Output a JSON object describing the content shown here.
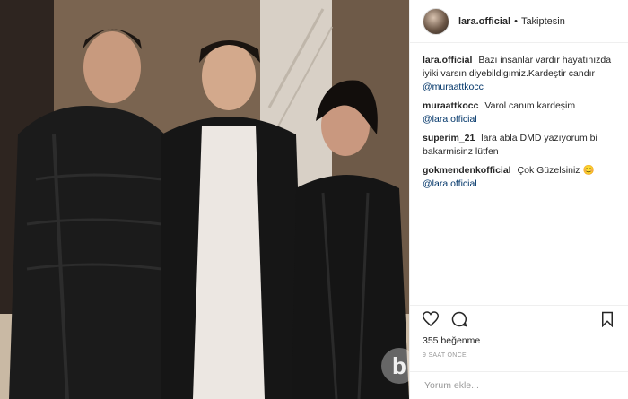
{
  "header": {
    "username": "lara.official",
    "separator": "•",
    "follow_status": "Takiptesin"
  },
  "comments": [
    {
      "user": "lara.official",
      "text": "Bazı insanlar vardır hayatınızda iyiki varsın diyebildigımiz.Kardeştir candır",
      "mention": "@muraattkocc"
    },
    {
      "user": "muraattkocc",
      "text": "Varol canım kardeşim",
      "mention": "@lara.official"
    },
    {
      "user": "superim_21",
      "text": "lara abla DMD yazıyorum bi bakarmisinz lütfen",
      "mention": ""
    },
    {
      "user": "gokmendenkofficial",
      "text": "Çok Güzelsiniz 😊",
      "mention": "@lara.official"
    }
  ],
  "likes": "355 beğenme",
  "time": "9 SAAT ÖNCE",
  "add_comment": {
    "placeholder": "Yorum ekle..."
  },
  "watermark": "b",
  "icons": {
    "like": "heart-icon",
    "comment": "comment-icon",
    "save": "bookmark-icon"
  },
  "colors": {
    "text": "#262626",
    "mention": "#003569",
    "muted": "#999999",
    "border": "#efefef"
  }
}
